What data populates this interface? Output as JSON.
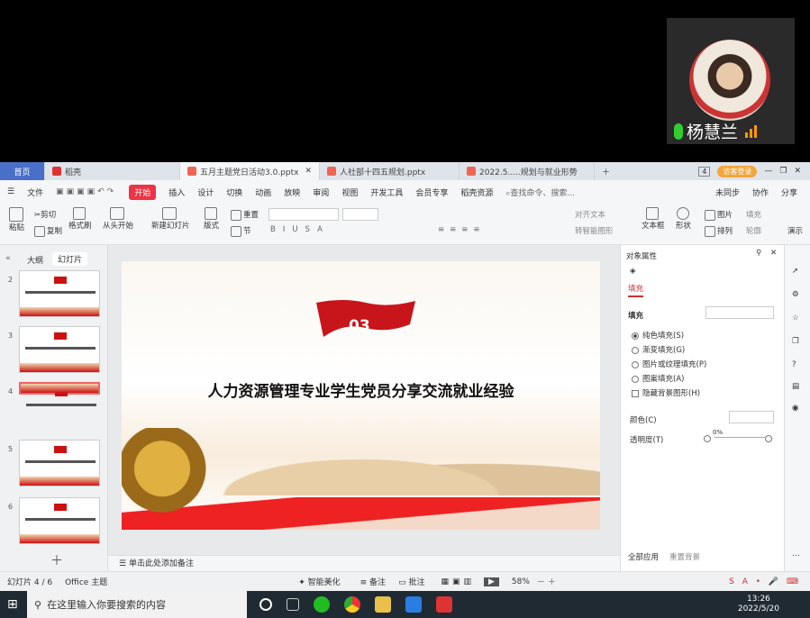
{
  "video": {
    "name": "杨慧兰"
  },
  "tabs": {
    "home": "首页",
    "t1": "稻壳",
    "t2": "五月主题党日活动3.0.pptx",
    "t3": "人社部十四五规划.pptx",
    "t4": "2022.5.....规划与就业形势",
    "visitor": "访客登录",
    "page_num": "4"
  },
  "menu": {
    "file": "文件",
    "items": [
      "开始",
      "插入",
      "设计",
      "切换",
      "动画",
      "放映",
      "审阅",
      "视图",
      "开发工具",
      "会员专享",
      "稻壳资源"
    ],
    "search": "查找命令、搜索...",
    "sync": "未同步",
    "collab": "协作",
    "share": "分享"
  },
  "ribbon": {
    "paste": "粘贴",
    "cut": "剪切",
    "copy": "复制",
    "format_brush": "格式刷",
    "from_start": "从头开始",
    "new_slide": "新建幻灯片",
    "layout": "版式",
    "section": "节",
    "reset": "重置",
    "align_text": "对齐文本",
    "smart_convert": "转智能图形",
    "textbox": "文本框",
    "shape": "形状",
    "picture": "图片",
    "arrange": "排列",
    "fill": "填充",
    "outline": "轮廓",
    "play": "演示"
  },
  "left": {
    "outline_tab": "大纲",
    "slides_tab": "幻灯片",
    "slide_nums": [
      "2",
      "3",
      "4",
      "5",
      "6"
    ]
  },
  "slide": {
    "badge": "03",
    "title": "人力资源管理专业学生党员分享交流就业经验"
  },
  "notes": {
    "placeholder": "单击此处添加备注"
  },
  "props": {
    "header": "对象属性",
    "fill_tab": "填充",
    "fill_section": "填充",
    "opt1": "纯色填充(S)",
    "opt2": "渐变填充(G)",
    "opt3": "图片或纹理填充(P)",
    "opt4": "图案填充(A)",
    "hide_bg": "隐藏背景图形(H)",
    "color_label": "颜色(C)",
    "transparency_label": "透明度(T)",
    "transparency_value": "0%",
    "apply_all": "全部应用",
    "reset_bg": "重置背景"
  },
  "status": {
    "slide_info": "幻灯片 4 / 6",
    "theme": "Office 主题",
    "beautify": "智能美化",
    "notes": "备注",
    "comments": "批注",
    "zoom": "58%"
  },
  "taskbar": {
    "search": "在这里输入你要搜索的内容",
    "time": "13:26",
    "date": "2022/5/20"
  }
}
